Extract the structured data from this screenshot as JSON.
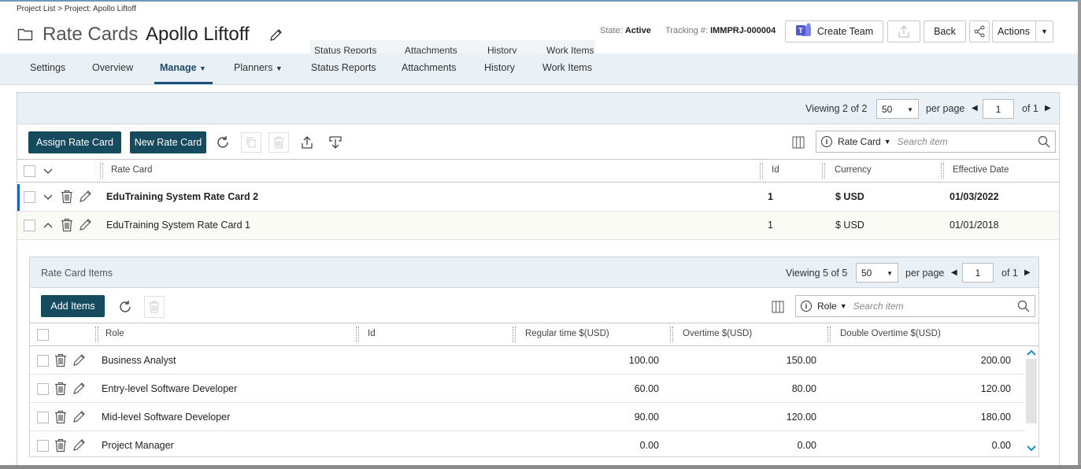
{
  "breadcrumb": "Project List > Project: Apollo Liftoff",
  "header": {
    "title": "Rate Cards",
    "project_name": "Apollo Liftoff",
    "state_label": "State:",
    "state_value": "Active",
    "tracking_label": "Tracking #:",
    "tracking_value": "IMMPRJ-000004",
    "create_team_label": "Create Team",
    "back_label": "Back",
    "actions_label": "Actions"
  },
  "ghost_tabs": [
    "Status Reports",
    "Attachments",
    "History",
    "Work Items"
  ],
  "nav": {
    "items": [
      "Settings",
      "Overview",
      "Manage",
      "Planners",
      "Status Reports",
      "Attachments",
      "History",
      "Work Items"
    ],
    "active": "Manage"
  },
  "rate_cards": {
    "viewing_label": "Viewing",
    "viewing_value": "2 of 2",
    "per_page_value": "50",
    "per_page_label": "per page",
    "page_value": "1",
    "of_pages": "of 1",
    "assign_btn": "Assign Rate Card",
    "new_btn": "New Rate Card",
    "search_field": "Rate Card",
    "search_placeholder": "Search item",
    "columns": [
      "Rate Card",
      "Id",
      "Currency",
      "Effective Date"
    ],
    "rows": [
      {
        "name": "EduTraining System Rate Card 2",
        "id": "1",
        "currency": "$ USD",
        "date": "01/03/2022"
      },
      {
        "name": "EduTraining System Rate Card 1",
        "id": "1",
        "currency": "$ USD",
        "date": "01/01/2018"
      }
    ]
  },
  "items": {
    "title": "Rate Card Items",
    "viewing_label": "Viewing",
    "viewing_value": "5 of 5",
    "per_page_value": "50",
    "per_page_label": "per page",
    "page_value": "1",
    "of_pages": "of 1",
    "add_btn": "Add Items",
    "search_field": "Role",
    "search_placeholder": "Search item",
    "columns": [
      "Role",
      "Id",
      "Regular time $(USD)",
      "Overtime $(USD)",
      "Double Overtime $(USD)"
    ],
    "rows": [
      {
        "role": "Business Analyst",
        "id": "",
        "regular": "100.00",
        "overtime": "150.00",
        "double": "200.00"
      },
      {
        "role": "Entry-level Software Developer",
        "id": "",
        "regular": "60.00",
        "overtime": "80.00",
        "double": "120.00"
      },
      {
        "role": "Mid-level Software Developer",
        "id": "",
        "regular": "90.00",
        "overtime": "120.00",
        "double": "180.00"
      },
      {
        "role": "Project Manager",
        "id": "",
        "regular": "0.00",
        "overtime": "0.00",
        "double": "0.00"
      }
    ]
  },
  "colors": {
    "primary": "#164a5e",
    "nav_bg": "#e9f1f6",
    "teams": "#5059c9"
  }
}
